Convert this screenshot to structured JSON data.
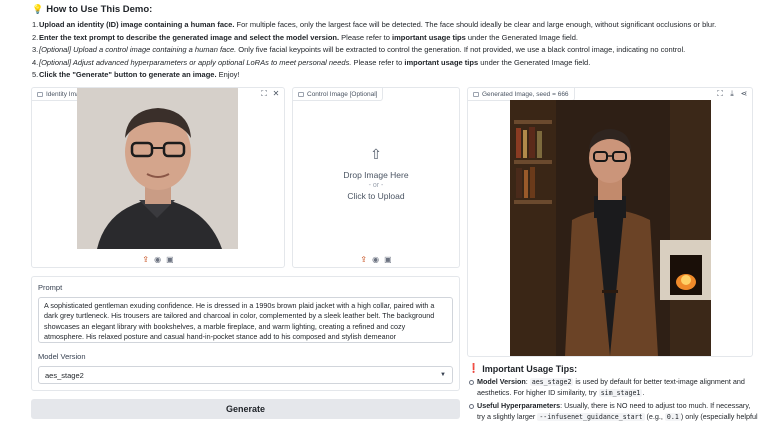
{
  "howto": {
    "icon": "lightbulb-icon",
    "title": "How to Use This Demo:",
    "steps": [
      {
        "num": "1.",
        "bold": "Upload an identity (ID) image containing a human face.",
        "rest": " For multiple faces, only the largest face will be detected. The face should ideally be clear and large enough, without significant occlusions or blur."
      },
      {
        "num": "2.",
        "bold": "Enter the text prompt to describe the generated image and select the model version.",
        "rest": " Please refer to ",
        "bold2": "important usage tips",
        "rest2": " under the Generated Image field."
      },
      {
        "num": "3.",
        "ital": "[Optional] Upload a control image containing a human face.",
        "rest": " Only five facial keypoints will be extracted to control the generation. If not provided, we use a black control image, indicating no control."
      },
      {
        "num": "4.",
        "ital": "[Optional] Adjust advanced hyperparameters or apply optional LoRAs to meet personal needs.",
        "rest": " Please refer to ",
        "bold2": "important usage tips",
        "rest2": " under the Generated Image field."
      },
      {
        "num": "5.",
        "bold": "Click the \"Generate\" button to generate an image.",
        "rest": " Enjoy!"
      }
    ]
  },
  "identity_panel": {
    "label": "Identity Image",
    "top_icons": [
      "fullscreen-icon",
      "close-icon"
    ],
    "bottom_icons": [
      "upload-icon",
      "webcam-icon",
      "clipboard-icon"
    ]
  },
  "control_panel": {
    "label": "Control Image [Optional]",
    "drop_text": "Drop Image Here",
    "or_text": "- or -",
    "click_text": "Click to Upload",
    "bottom_icons": [
      "upload-icon",
      "webcam-icon",
      "clipboard-icon"
    ]
  },
  "generated_panel": {
    "label": "Generated Image, seed = 666",
    "top_icons": [
      "fullscreen-icon",
      "download-icon",
      "share-icon"
    ]
  },
  "prompt": {
    "label": "Prompt",
    "value": "A sophisticated gentleman exuding confidence. He is dressed in a 1990s brown plaid jacket with a high collar, paired with a dark grey turtleneck. His trousers are tailored and charcoal in color, complemented by a sleek leather belt. The background showcases an elegant library with bookshelves, a marble fireplace, and warm lighting, creating a refined and cozy atmosphere. His relaxed posture and casual hand-in-pocket stance add to his composed and stylish demeanor"
  },
  "model_version": {
    "label": "Model Version",
    "value": "aes_stage2"
  },
  "generate_button": {
    "label": "Generate"
  },
  "tips": {
    "title": "Important Usage Tips:",
    "items": [
      {
        "bold": "Model Version",
        "a": ": ",
        "code1": "aes_stage2",
        "b": " is used by default for better text-image alignment and aesthetics. For higher ID similarity, try ",
        "code2": "sim_stage1",
        "c": "."
      },
      {
        "bold": "Useful Hyperparameters",
        "a": ": Usually, there is NO need to adjust too much. If necessary, try a slightly larger ",
        "code1": "--infusenet_guidance_start",
        "b": " (e.g., ",
        "code2": "0.1",
        "c": ") only (especially helpful"
      }
    ]
  },
  "colors": {
    "accent_orange": "#c2410c",
    "tip_red": "#dc2626",
    "button_bg": "#e5e7eb"
  }
}
